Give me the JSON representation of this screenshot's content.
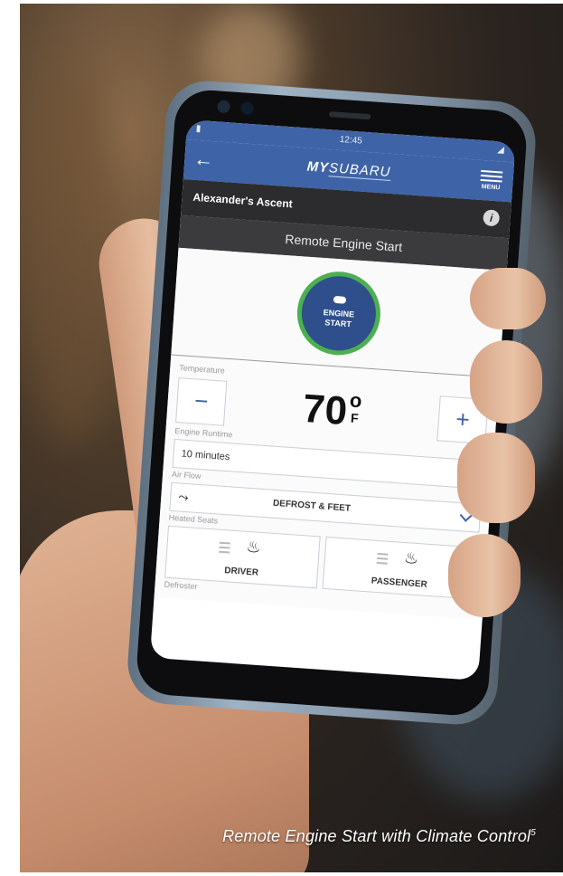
{
  "status_bar": {
    "time": "12:45"
  },
  "app_bar": {
    "logo_bold": "MY",
    "logo_rest": "SUBARU",
    "menu_label": "MENU"
  },
  "vehicle": {
    "name": "Alexander's Ascent"
  },
  "screen_title": "Remote Engine Start",
  "engine_start": {
    "line1": "ENGINE",
    "line2": "START"
  },
  "temperature": {
    "label": "Temperature",
    "value": "70",
    "degree_symbol": "o",
    "unit": "F",
    "decrease_symbol": "−",
    "increase_symbol": "+"
  },
  "engine_runtime": {
    "label": "Engine Runtime",
    "selected": "10 minutes"
  },
  "air_flow": {
    "label": "Air Flow",
    "selected": "DEFROST & FEET"
  },
  "heated_seats": {
    "label": "Heated Seats",
    "driver": "DRIVER",
    "passenger": "PASSENGER"
  },
  "defroster": {
    "label": "Defroster"
  },
  "caption": {
    "text": "Remote Engine Start with Climate Control",
    "footnote": "5"
  },
  "colors": {
    "brand_blue": "#3e63a6",
    "engine_button": "#2e4f8c",
    "active_ring": "#4cb050"
  },
  "icons": [
    "back-arrow-icon",
    "menu-icon",
    "info-icon",
    "key-fob-icon",
    "chevron-down-icon",
    "air-flow-icon",
    "heated-seat-icon"
  ]
}
